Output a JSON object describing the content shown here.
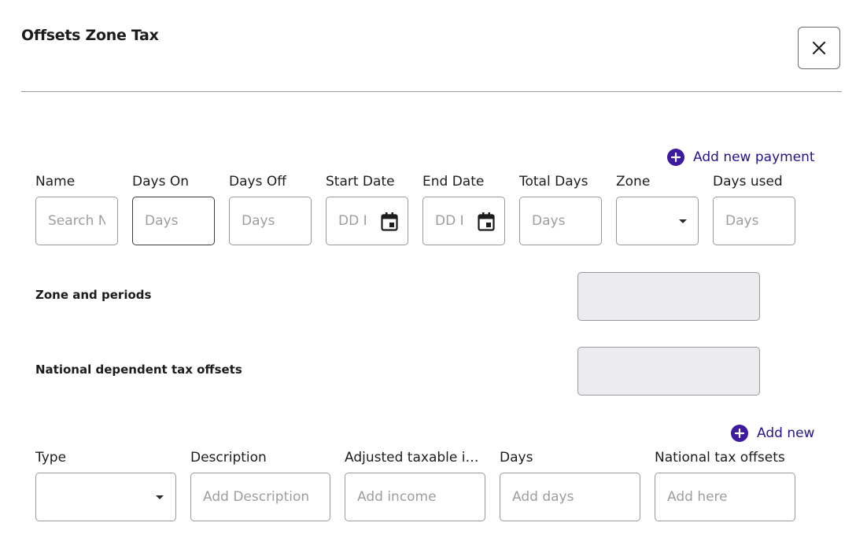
{
  "dialog": {
    "title": "Offsets Zone Tax"
  },
  "payment": {
    "add_label": "Add new payment",
    "fields": {
      "name": {
        "label": "Name",
        "placeholder": "Search N"
      },
      "days_on": {
        "label": "Days On",
        "placeholder": "Days"
      },
      "days_off": {
        "label": "Days Off",
        "placeholder": "Days"
      },
      "start_date": {
        "label": "Start Date",
        "placeholder": "DD I"
      },
      "end_date": {
        "label": "End Date",
        "placeholder": "DD I"
      },
      "total_days": {
        "label": "Total Days",
        "placeholder": "Days"
      },
      "zone": {
        "label": "Zone",
        "value": ""
      },
      "days_used": {
        "label": "Days used",
        "placeholder": "Days"
      }
    }
  },
  "summary": {
    "zone_periods_label": "Zone and periods",
    "national_dependent_label": "National dependent tax offsets"
  },
  "offsets": {
    "add_label": "Add new",
    "fields": {
      "type": {
        "label": "Type",
        "value": ""
      },
      "description": {
        "label": "Description",
        "placeholder": "Add Description"
      },
      "adjusted_income": {
        "label": "Adjusted taxable in...",
        "placeholder": "Add income"
      },
      "days": {
        "label": "Days",
        "placeholder": "Add days"
      },
      "national_offsets": {
        "label": "National tax offsets",
        "placeholder": "Add here"
      }
    }
  }
}
